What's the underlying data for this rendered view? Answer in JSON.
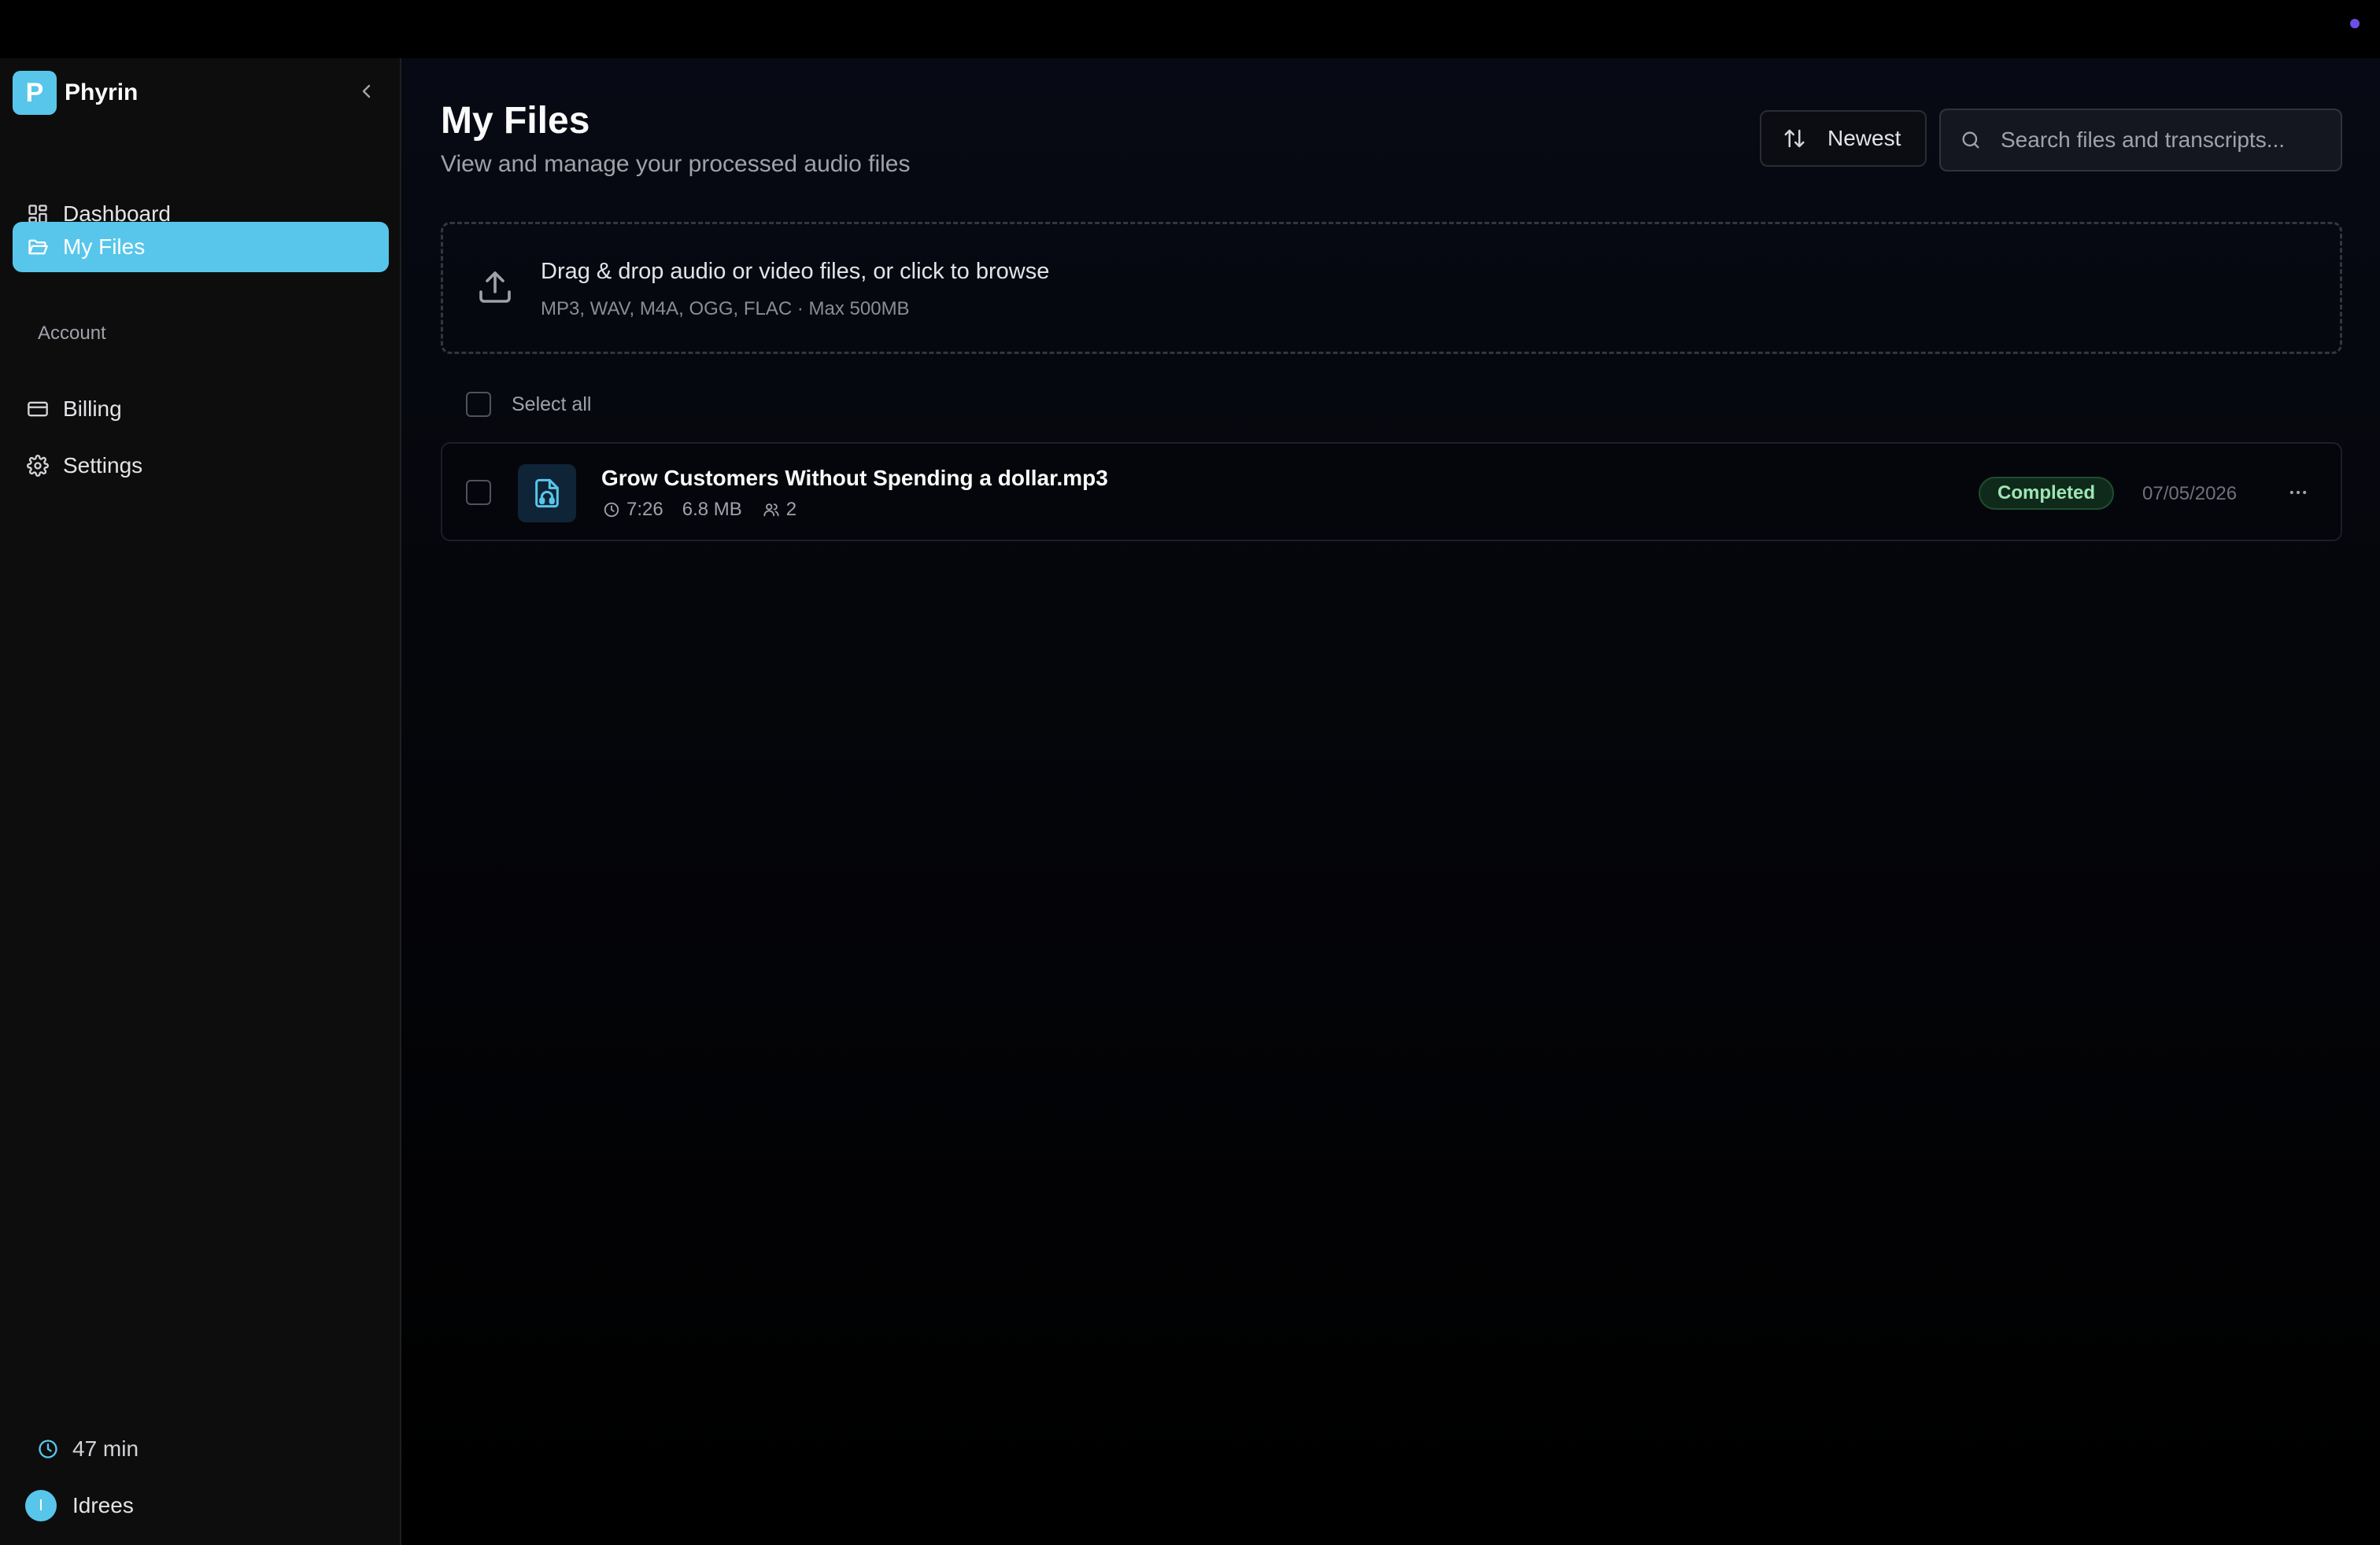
{
  "app": {
    "name": "Phyrin",
    "logo_letter": "P"
  },
  "sidebar": {
    "items": [
      {
        "label": "Dashboard",
        "icon": "dashboard-icon"
      },
      {
        "label": "My Files",
        "icon": "folder-open-icon",
        "active": true
      }
    ],
    "account_section": "Account",
    "account_items": [
      {
        "label": "Billing",
        "icon": "credit-card-icon"
      },
      {
        "label": "Settings",
        "icon": "gear-icon"
      }
    ],
    "usage": "47 min",
    "user": {
      "name": "Idrees",
      "initial": "I"
    }
  },
  "header": {
    "title": "My Files",
    "subtitle": "View and manage your processed audio files",
    "sort_label": "Newest",
    "search_placeholder": "Search files and transcripts..."
  },
  "dropzone": {
    "title": "Drag & drop audio or video files, or click to browse",
    "hint": "MP3, WAV, M4A, OGG, FLAC · Max 500MB"
  },
  "list": {
    "select_all_label": "Select all",
    "files": [
      {
        "name": "Grow Customers Without Spending a dollar.mp3",
        "duration": "7:26",
        "size": "6.8 MB",
        "speakers": "2",
        "status": "Completed",
        "date": "07/05/2026"
      }
    ]
  },
  "colors": {
    "accent": "#58c6ea",
    "status_completed": "#9ee6b5",
    "indicator_dot": "#6d4ee8"
  }
}
